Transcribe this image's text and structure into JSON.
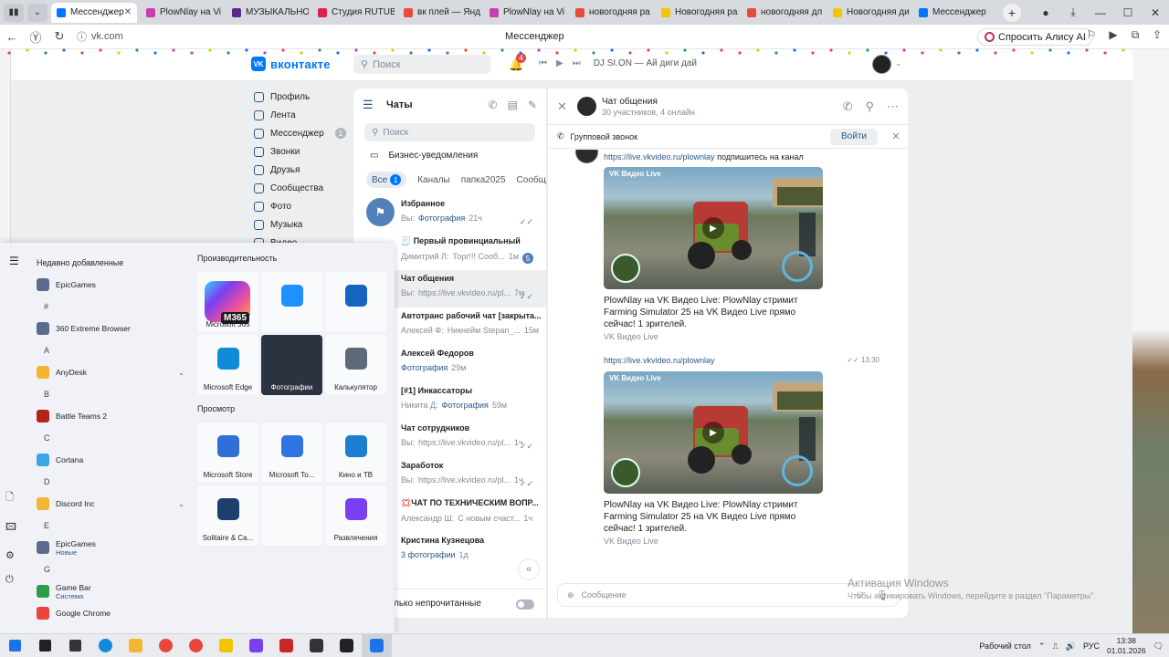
{
  "browser": {
    "tabs": [
      {
        "label": "Мессенджер",
        "color": "#0077ff",
        "active": true
      },
      {
        "label": "PlowNlay на Vi",
        "color": "#c63fae"
      },
      {
        "label": "МУЗЫКАЛЬНО",
        "color": "#5a2a8a"
      },
      {
        "label": "Студия RUTUB",
        "color": "#e0224c"
      },
      {
        "label": "вк плей — Янд",
        "color": "#e84b3c"
      },
      {
        "label": "PlowNlay на Vi",
        "color": "#c63fae"
      },
      {
        "label": "новогодняя ра",
        "color": "#e84b3c"
      },
      {
        "label": "Новогодняя ра",
        "color": "#f2c500"
      },
      {
        "label": "новогодняя дл",
        "color": "#e84b3c"
      },
      {
        "label": "Новогодняя ди",
        "color": "#f2c500"
      },
      {
        "label": "Мессенджер",
        "color": "#0077ff"
      }
    ],
    "url": "vk.com",
    "page_title": "Мессенджер",
    "alice_label": "Спросить Алису AI"
  },
  "vk": {
    "logo_text": "вконтакте",
    "search_placeholder": "Поиск",
    "notif_count": "4",
    "player_track": "DJ SI.ON — Ай диги дай",
    "menu": [
      {
        "label": "Профиль"
      },
      {
        "label": "Лента"
      },
      {
        "label": "Мессенджер",
        "count": "1"
      },
      {
        "label": "Звонки"
      },
      {
        "label": "Друзья"
      },
      {
        "label": "Сообщества"
      },
      {
        "label": "Фото"
      },
      {
        "label": "Музыка"
      },
      {
        "label": "Видео"
      }
    ],
    "chats": {
      "title": "Чаты",
      "search_placeholder": "Поиск",
      "business": "Бизнес-уведомления",
      "filters": {
        "all": "Все",
        "all_count": "1",
        "channels": "Каналы",
        "folder": "папка2025",
        "communities": "Сообщ"
      },
      "items": [
        {
          "name": "Избранное",
          "prefix": "Вы:",
          "hl": "Фотография",
          "time": "21ч",
          "read": true
        },
        {
          "name": "🧾 Первый провинциальный",
          "prefix": "Димитрий Л:",
          "text": "Торг!!! Сооб...",
          "time": "1м",
          "unread": "5"
        },
        {
          "name": "Чат общения",
          "prefix": "Вы:",
          "text": "https://live.vkvideo.ru/pl...",
          "time": "7м",
          "read": true,
          "selected": true
        },
        {
          "name": "Автотранс рабочий чат [закрыта...",
          "prefix": "Алексей Ф:",
          "text": "Никнейм Stepan_...",
          "time": "15м"
        },
        {
          "name": "Алексей Федоров",
          "prefix": "",
          "hl": "Фотография",
          "time": "29м"
        },
        {
          "name": "[#1] Инкассаторы",
          "prefix": "Никита Д:",
          "hl": "Фотография",
          "time": "59м"
        },
        {
          "name": "Чат сотрудников",
          "prefix": "Вы:",
          "text": "https://live.vkvideo.ru/pl...",
          "time": "1ч",
          "read": true
        },
        {
          "name": "Заработок",
          "prefix": "Вы:",
          "text": "https://live.vkvideo.ru/pl...",
          "time": "1ч",
          "read": true
        },
        {
          "name": "💢ЧАТ ПО ТЕХНИЧЕСКИМ ВОПР...",
          "prefix": "Александр Ш:",
          "text": "С новым счаст...",
          "time": "1ч"
        },
        {
          "name": "Кристина Кузнецова",
          "prefix": "",
          "hl": "3 фотографии",
          "time": "1д"
        }
      ],
      "footer": "лько непрочитанные"
    },
    "conversation": {
      "name": "Чат общения",
      "subtitle": "30 участников, 4 онлайн",
      "call_label": "Групповой звонок",
      "join_label": "Войти",
      "msg1_link": "https://live.vkvideo.ru/plownlay",
      "msg1_text": "подпишитесь на канал",
      "video_label": "VK Видео Live",
      "video_text": "PlowNlay на VK Видео Live: PlowNlay стримит Farming Simulator 25 на VK Видео Live прямо сейчас! 1 зрителей.",
      "video_source": "VK Видео Live",
      "msg2_link": "https://live.vkvideo.ru/plownlay",
      "msg2_time": "13:30",
      "composer_placeholder": "Сообщение"
    }
  },
  "start_menu": {
    "recent_title": "Недавно добавленные",
    "apps": [
      {
        "type": "app",
        "label": "EpicGames",
        "color": "#5b6b8c"
      },
      {
        "type": "letter",
        "label": "#"
      },
      {
        "type": "app",
        "label": "360 Extreme Browser",
        "color": "#5b6b8c"
      },
      {
        "type": "letter",
        "label": "A"
      },
      {
        "type": "app",
        "label": "AnyDesk",
        "color": "#f2b632",
        "chevron": true
      },
      {
        "type": "letter",
        "label": "B"
      },
      {
        "type": "app",
        "label": "Battle Teams 2",
        "color": "#b42318"
      },
      {
        "type": "letter",
        "label": "C"
      },
      {
        "type": "app",
        "label": "Cortana",
        "color": "#3aa5e8"
      },
      {
        "type": "letter",
        "label": "D"
      },
      {
        "type": "app",
        "label": "Discord Inc",
        "color": "#f2b632",
        "chevron": true
      },
      {
        "type": "letter",
        "label": "E"
      },
      {
        "type": "app",
        "label": "EpicGames",
        "sub": "Новые",
        "color": "#5b6b8c"
      },
      {
        "type": "letter",
        "label": "G"
      },
      {
        "type": "app",
        "label": "Game Bar",
        "sub": "Система",
        "color": "#2e9b4d"
      },
      {
        "type": "app",
        "label": "Google Chrome",
        "color": "#e8453c"
      }
    ],
    "productivity_title": "Производительность",
    "productivity": [
      {
        "label": "Microsoft 365",
        "kind": "m365"
      },
      {
        "label": "",
        "color": "#1e90ff"
      },
      {
        "label": "",
        "color": "#1565c0"
      },
      {
        "label": "Microsoft Edge",
        "color": "#0f8bd9"
      },
      {
        "label": "Фотографии",
        "kind": "thumb"
      },
      {
        "label": "Калькулятор",
        "color": "#5c6a7a"
      }
    ],
    "view_title": "Просмотр",
    "view": [
      {
        "label": "Microsoft Store",
        "color": "#2f6fd6"
      },
      {
        "label": "Microsoft To...",
        "color": "#2f74e0"
      },
      {
        "label": "Кино и ТВ",
        "color": "#1a7fd1"
      },
      {
        "label": "Solitaire & Ca...",
        "color": "#1d3f6e"
      },
      {
        "label": "",
        "kind": "blank"
      },
      {
        "label": "Развлечения",
        "color": "#7b3ff2"
      }
    ],
    "m365_tag": "M365"
  },
  "watermark": {
    "title": "Активация Windows",
    "sub": "Чтобы активировать Windows, перейдите в раздел \"Параметры\"."
  },
  "taskbar": {
    "icons": [
      {
        "name": "start",
        "color": "#1a73e8"
      },
      {
        "name": "search",
        "color": "#222"
      },
      {
        "name": "taskview",
        "color": "#333"
      },
      {
        "name": "edge",
        "color": "#0f8bd9"
      },
      {
        "name": "explorer",
        "color": "#f2b632"
      },
      {
        "name": "yandex",
        "color": "#e8453c"
      },
      {
        "name": "chrome",
        "color": "#e8453c"
      },
      {
        "name": "app-yellow",
        "color": "#f2c500"
      },
      {
        "name": "app-purple",
        "color": "#7b3ff2"
      },
      {
        "name": "app-red",
        "color": "#c62828"
      },
      {
        "name": "obs",
        "color": "#333"
      },
      {
        "name": "app-dark",
        "color": "#222"
      },
      {
        "name": "app-active",
        "color": "#1a73e8",
        "active": true
      }
    ],
    "desktop_label": "Рабочий стол",
    "lang": "РУС",
    "time": "13:38",
    "date": "01.01.2026"
  }
}
